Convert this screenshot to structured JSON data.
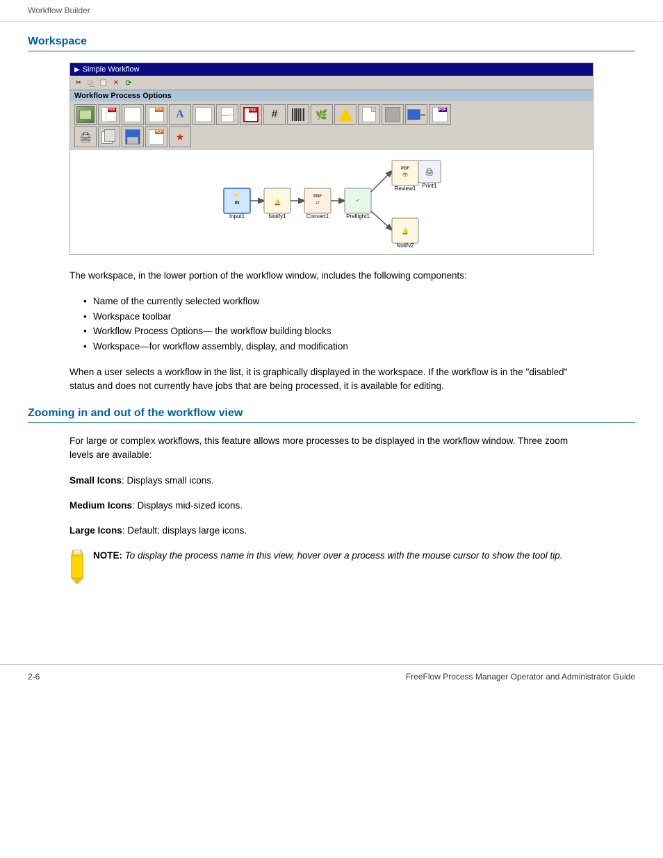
{
  "breadcrumb": {
    "text": "Workflow Builder"
  },
  "workspace_section": {
    "heading": "Workspace",
    "screenshot": {
      "title": "Simple Workflow",
      "options_label": "Workflow Process Options",
      "nodes": [
        {
          "id": "Input",
          "label": "Input1",
          "type": "input"
        },
        {
          "id": "Notify",
          "label": "Notify1",
          "type": "notify"
        },
        {
          "id": "Convert",
          "label": "Convert1",
          "type": "convert"
        },
        {
          "id": "Preflight",
          "label": "Preflight1",
          "type": "preflight"
        },
        {
          "id": "Review",
          "label": "Review1",
          "type": "review"
        },
        {
          "id": "Print",
          "label": "Print1",
          "type": "print"
        },
        {
          "id": "Notify2",
          "label": "Notify2",
          "type": "notify"
        }
      ]
    },
    "intro_text": "The workspace, in the lower portion of the workflow window, includes the following components:",
    "bullets": [
      "Name of the currently selected workflow",
      "Workspace toolbar",
      "Workflow Process Options— the workflow building blocks",
      "Workspace—for workflow assembly, display, and modification"
    ],
    "body_text": "When a user selects a workflow in the list, it is graphically displayed in the workspace. If the workflow is in the \"disabled\" status and does not currently have jobs that are being processed, it is available for editing."
  },
  "zoom_section": {
    "heading": "Zooming in and out of the workflow view",
    "intro_text": "For large or complex workflows, this feature allows more processes to be displayed in the workflow window. Three zoom levels are available:",
    "small_icons_label": "Small Icons",
    "small_icons_text": ": Displays small icons.",
    "medium_icons_label": "Medium Icons",
    "medium_icons_text": ": Displays mid-sized icons.",
    "large_icons_label": "Large Icons",
    "large_icons_text": ": Default; displays large icons.",
    "note_label": "NOTE:",
    "note_text": " To display the process name in this view, hover over a process with the mouse cursor to show the tool tip."
  },
  "footer": {
    "page_num": "2-6",
    "guide_title": "FreeFlow Process Manager Operator and Administrator Guide"
  }
}
